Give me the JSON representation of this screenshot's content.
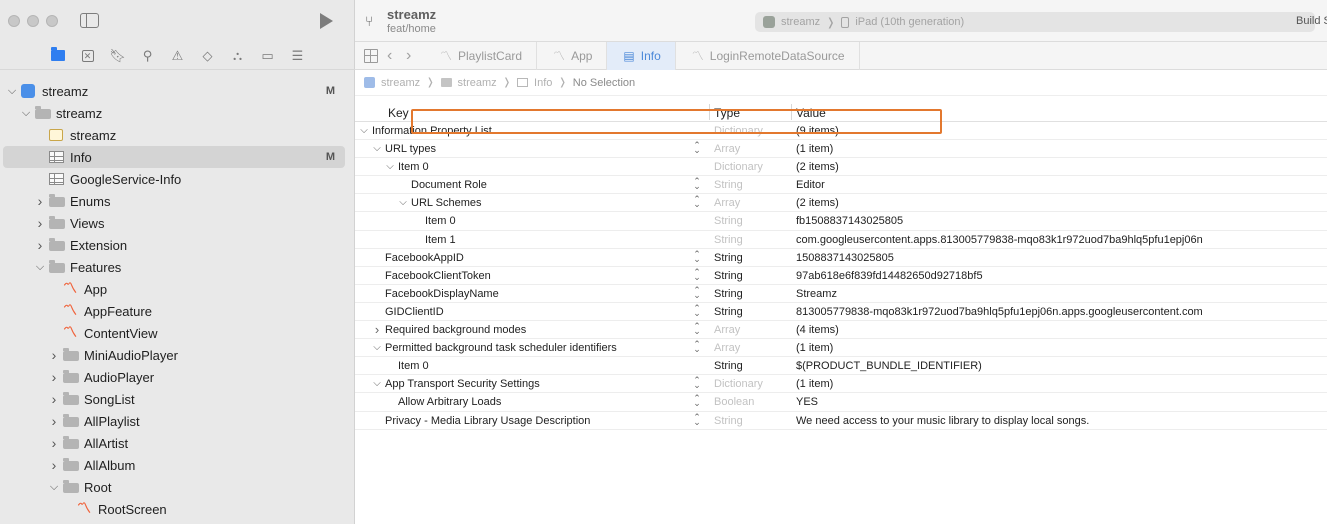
{
  "project": {
    "name": "streamz",
    "branch": "feat/home"
  },
  "scheme": {
    "target": "streamz",
    "device": "iPad (10th generation)",
    "build_status": "Build S"
  },
  "tabs": [
    {
      "label": "PlaylistCard",
      "kind": "swift",
      "active": false
    },
    {
      "label": "App",
      "kind": "swift",
      "active": false
    },
    {
      "label": "Info",
      "kind": "plist",
      "active": true
    },
    {
      "label": "LoginRemoteDataSource",
      "kind": "swift",
      "active": false
    }
  ],
  "jumpbar": [
    "streamz",
    "streamz",
    "Info",
    "No Selection"
  ],
  "navigator": {
    "items": [
      {
        "label": "streamz",
        "level": 0,
        "icon": "project",
        "disclosure": "open",
        "badge": "M"
      },
      {
        "label": "streamz",
        "level": 1,
        "icon": "folder",
        "disclosure": "open",
        "badge": ""
      },
      {
        "label": "streamz",
        "level": 2,
        "icon": "asset",
        "disclosure": "",
        "badge": ""
      },
      {
        "label": "Info",
        "level": 2,
        "icon": "plist",
        "disclosure": "",
        "badge": "M",
        "selected": true
      },
      {
        "label": "GoogleService-Info",
        "level": 2,
        "icon": "plist",
        "disclosure": "",
        "badge": ""
      },
      {
        "label": "Enums",
        "level": 2,
        "icon": "folder",
        "disclosure": "closed",
        "badge": ""
      },
      {
        "label": "Views",
        "level": 2,
        "icon": "folder",
        "disclosure": "closed",
        "badge": ""
      },
      {
        "label": "Extension",
        "level": 2,
        "icon": "folder",
        "disclosure": "closed",
        "badge": ""
      },
      {
        "label": "Features",
        "level": 2,
        "icon": "folder",
        "disclosure": "open",
        "badge": ""
      },
      {
        "label": "App",
        "level": 3,
        "icon": "swift",
        "disclosure": "",
        "badge": ""
      },
      {
        "label": "AppFeature",
        "level": 3,
        "icon": "swift",
        "disclosure": "",
        "badge": ""
      },
      {
        "label": "ContentView",
        "level": 3,
        "icon": "swift",
        "disclosure": "",
        "badge": ""
      },
      {
        "label": "MiniAudioPlayer",
        "level": 3,
        "icon": "folder",
        "disclosure": "closed",
        "badge": ""
      },
      {
        "label": "AudioPlayer",
        "level": 3,
        "icon": "folder",
        "disclosure": "closed",
        "badge": ""
      },
      {
        "label": "SongList",
        "level": 3,
        "icon": "folder",
        "disclosure": "closed",
        "badge": ""
      },
      {
        "label": "AllPlaylist",
        "level": 3,
        "icon": "folder",
        "disclosure": "closed",
        "badge": ""
      },
      {
        "label": "AllArtist",
        "level": 3,
        "icon": "folder",
        "disclosure": "closed",
        "badge": ""
      },
      {
        "label": "AllAlbum",
        "level": 3,
        "icon": "folder",
        "disclosure": "closed",
        "badge": ""
      },
      {
        "label": "Root",
        "level": 3,
        "icon": "folder",
        "disclosure": "open",
        "badge": ""
      },
      {
        "label": "RootScreen",
        "level": 4,
        "icon": "swift",
        "disclosure": "",
        "badge": ""
      }
    ]
  },
  "plist": {
    "headers": {
      "key": "Key",
      "type": "Type",
      "value": "Value"
    },
    "rows": [
      {
        "key": "Information Property List",
        "indent": 0,
        "disclosure": "open",
        "stepper": false,
        "type": "Dictionary",
        "type_dim": true,
        "value": "(9 items)"
      },
      {
        "key": "URL types",
        "indent": 1,
        "disclosure": "open",
        "stepper": true,
        "type": "Array",
        "type_dim": true,
        "value": "(1 item)"
      },
      {
        "key": "Item 0",
        "indent": 2,
        "disclosure": "open",
        "stepper": false,
        "type": "Dictionary",
        "type_dim": true,
        "value": "(2 items)"
      },
      {
        "key": "Document Role",
        "indent": 3,
        "disclosure": "",
        "stepper": true,
        "type": "String",
        "type_dim": true,
        "value": " Editor"
      },
      {
        "key": "URL Schemes",
        "indent": 3,
        "disclosure": "open",
        "stepper": true,
        "type": "Array",
        "type_dim": true,
        "value": "(2 items)"
      },
      {
        "key": "Item 0",
        "indent": 4,
        "disclosure": "",
        "stepper": false,
        "type": "String",
        "type_dim": true,
        "value": "fb1508837143025805"
      },
      {
        "key": "Item 1",
        "indent": 4,
        "disclosure": "",
        "stepper": false,
        "type": "String",
        "type_dim": true,
        "value": "com.googleusercontent.apps.813005779838-mqo83k1r972uod7ba9hlq5pfu1epj06n"
      },
      {
        "key": "FacebookAppID",
        "indent": 1,
        "disclosure": "",
        "stepper": true,
        "type": "String",
        "type_dim": false,
        "value": "1508837143025805"
      },
      {
        "key": "FacebookClientToken",
        "indent": 1,
        "disclosure": "",
        "stepper": true,
        "type": "String",
        "type_dim": false,
        "value": "97ab618e6f839fd14482650d92718bf5"
      },
      {
        "key": "FacebookDisplayName",
        "indent": 1,
        "disclosure": "",
        "stepper": true,
        "type": "String",
        "type_dim": false,
        "value": "Streamz"
      },
      {
        "key": "GIDClientID",
        "indent": 1,
        "disclosure": "",
        "stepper": true,
        "type": "String",
        "type_dim": false,
        "value": "813005779838-mqo83k1r972uod7ba9hlq5pfu1epj06n.apps.googleusercontent.com"
      },
      {
        "key": "Required background modes",
        "indent": 1,
        "disclosure": "closed",
        "stepper": true,
        "type": "Array",
        "type_dim": true,
        "value": "(4 items)"
      },
      {
        "key": "Permitted background task scheduler identifiers",
        "indent": 1,
        "disclosure": "open",
        "stepper": true,
        "type": "Array",
        "type_dim": true,
        "value": "(1 item)"
      },
      {
        "key": "Item 0",
        "indent": 2,
        "disclosure": "",
        "stepper": false,
        "type": "String",
        "type_dim": false,
        "value": "$(PRODUCT_BUNDLE_IDENTIFIER)"
      },
      {
        "key": "App Transport Security Settings",
        "indent": 1,
        "disclosure": "open",
        "stepper": true,
        "type": "Dictionary",
        "type_dim": true,
        "value": "(1 item)"
      },
      {
        "key": "Allow Arbitrary Loads",
        "indent": 2,
        "disclosure": "",
        "stepper": true,
        "type": "Boolean",
        "type_dim": true,
        "value": " YES"
      },
      {
        "key": "Privacy - Media Library Usage Description",
        "indent": 1,
        "disclosure": "",
        "stepper": true,
        "type": "String",
        "type_dim": true,
        "value": "We need access to your music library to display local songs."
      }
    ]
  },
  "colors": {
    "accent": "#2f7ef0",
    "highlight": "#e3782e",
    "selection": "#d4d4d4"
  }
}
